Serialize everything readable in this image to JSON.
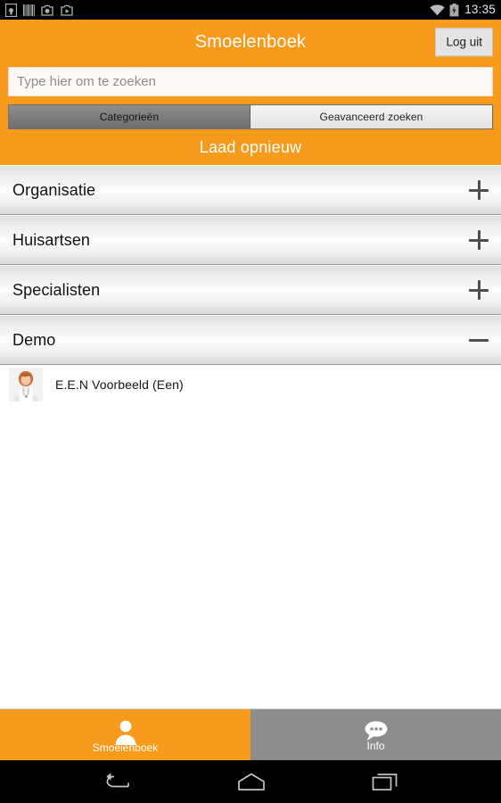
{
  "statusbar": {
    "time": "13:35",
    "left_icons": [
      {
        "name": "sdcard-icon"
      },
      {
        "name": "barcode-icon"
      },
      {
        "name": "screenshot-icon"
      },
      {
        "name": "screenshot-icon-2"
      }
    ],
    "right_icons": [
      {
        "name": "wifi-icon"
      },
      {
        "name": "battery-charging-icon"
      }
    ]
  },
  "header": {
    "title": "Smoelenboek",
    "logout_label": "Log uit",
    "accent_color": "#f89b1c"
  },
  "search": {
    "value": "",
    "placeholder": "Type hier om te zoeken"
  },
  "tabs": {
    "items": [
      {
        "label": "Categorieën",
        "active": true
      },
      {
        "label": "Geavanceerd zoeken",
        "active": false
      }
    ]
  },
  "reload": {
    "label": "Laad opnieuw"
  },
  "categories": [
    {
      "label": "Organisatie",
      "expanded": false,
      "toggle": "+"
    },
    {
      "label": "Huisartsen",
      "expanded": false,
      "toggle": "+"
    },
    {
      "label": "Specialisten",
      "expanded": false,
      "toggle": "+"
    },
    {
      "label": "Demo",
      "expanded": true,
      "toggle": "−"
    }
  ],
  "people": [
    {
      "name": "E.E.N Voorbeeld (Een)",
      "avatar": "doctor-photo"
    }
  ],
  "bottom_tabs": [
    {
      "label": "Smoelenboek",
      "icon": "person-icon",
      "active": true,
      "color": "#f89b1c"
    },
    {
      "label": "Info",
      "icon": "speech-bubble-icon",
      "active": false,
      "color": "#8d8d8d"
    }
  ],
  "navbar": {
    "buttons": [
      {
        "name": "back-button"
      },
      {
        "name": "home-button"
      },
      {
        "name": "recents-button"
      }
    ]
  }
}
